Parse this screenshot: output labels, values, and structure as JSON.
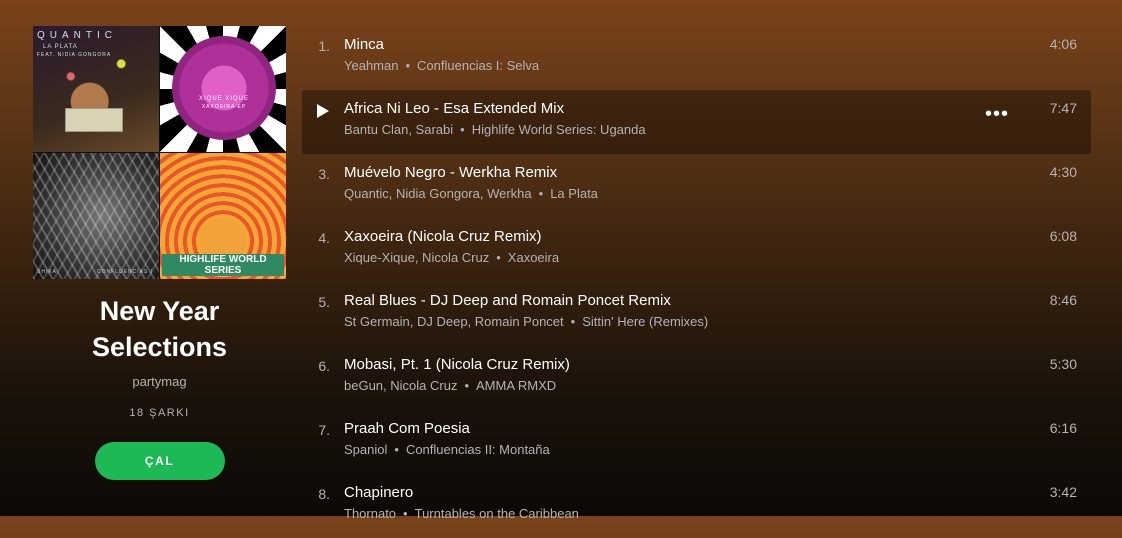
{
  "playlist": {
    "title": "New Year Selections",
    "owner": "partymag",
    "count": "18 ŞARKI",
    "play_label": "ÇAL",
    "cover_texts": {
      "tile1_title": "QUANTIC",
      "tile1_sub": "LA PLATA",
      "tile1_sub2": "FEAT. NIDIA GONGORA",
      "tile2_line1": "XIQUE XIQUE",
      "tile2_line2": "XAXOEIRA EP",
      "tile3_left": "SHIKA",
      "tile3_right": "CONFLUENCIAS I",
      "tile4_banner": "HIGHLIFE WORLD SERIES"
    }
  },
  "tracks": [
    {
      "num": "1.",
      "title": "Minca",
      "artists": "Yeahman",
      "album": "Confluencias I: Selva",
      "duration": "4:06"
    },
    {
      "num": "2.",
      "title": "Africa Ni Leo - Esa Extended Mix",
      "artists": "Bantu Clan, Sarabi",
      "album": "Highlife World Series: Uganda",
      "duration": "7:47"
    },
    {
      "num": "3.",
      "title": "Muévelo Negro - Werkha Remix",
      "artists": "Quantic, Nidia Gongora, Werkha",
      "album": "La Plata",
      "duration": "4:30"
    },
    {
      "num": "4.",
      "title": "Xaxoeira (Nicola Cruz Remix)",
      "artists": "Xique-Xique, Nicola Cruz",
      "album": "Xaxoeira",
      "duration": "6:08"
    },
    {
      "num": "5.",
      "title": "Real Blues - DJ Deep and Romain Poncet Remix",
      "artists": "St Germain, DJ Deep, Romain Poncet",
      "album": "Sittin' Here (Remixes)",
      "duration": "8:46"
    },
    {
      "num": "6.",
      "title": "Mobasi, Pt. 1 (Nicola Cruz Remix)",
      "artists": "beGun, Nicola Cruz",
      "album": "AMMA RMXD",
      "duration": "5:30"
    },
    {
      "num": "7.",
      "title": "Praah Com Poesia",
      "artists": "Spaniol",
      "album": "Confluencias II: Montaña",
      "duration": "6:16"
    },
    {
      "num": "8.",
      "title": "Chapinero",
      "artists": "Thornato",
      "album": "Turntables on the Caribbean",
      "duration": "3:42"
    }
  ],
  "separator": "•",
  "more_icon": "•••"
}
